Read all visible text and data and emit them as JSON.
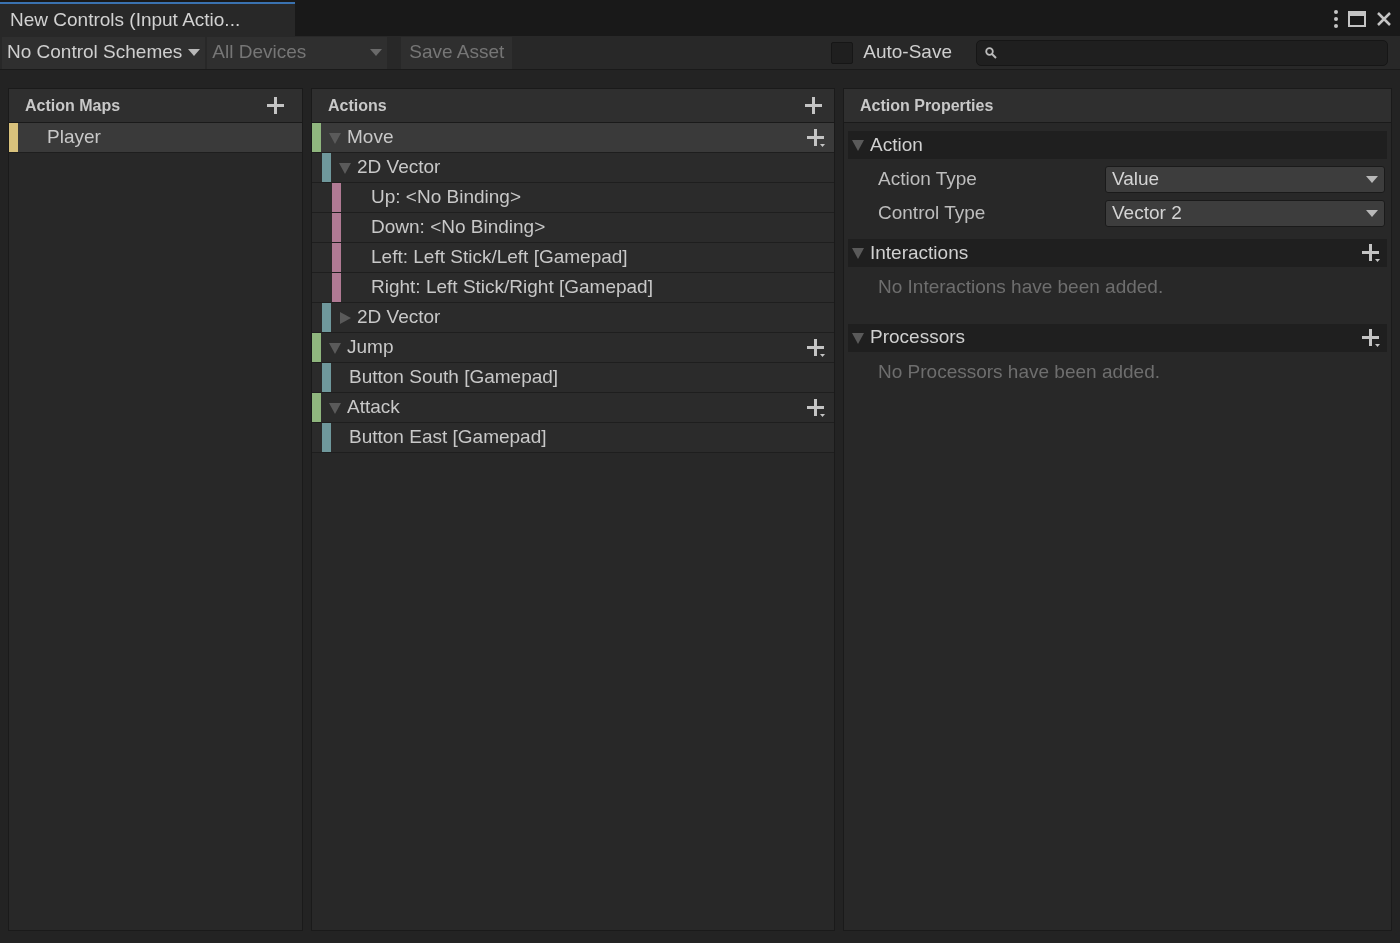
{
  "window": {
    "tab_title": "New Controls (Input Actio..."
  },
  "toolbar": {
    "control_schemes": "No Control Schemes",
    "devices": {
      "label": "All Devices",
      "disabled": true
    },
    "save_asset": {
      "label": "Save Asset",
      "disabled": true
    },
    "auto_save": {
      "label": "Auto-Save",
      "checked": false
    }
  },
  "action_maps": {
    "title": "Action Maps",
    "items": [
      {
        "label": "Player",
        "selected": true,
        "color": "#d9c27c"
      }
    ]
  },
  "actions": {
    "title": "Actions",
    "items": [
      {
        "kind": "action",
        "label": "Move",
        "selected": true,
        "expanded": true,
        "children": [
          {
            "kind": "composite",
            "label": "2D Vector",
            "selected": false,
            "expanded": true,
            "children": [
              {
                "kind": "part",
                "label": "Up: <No Binding>",
                "selected": false
              },
              {
                "kind": "part",
                "label": "Down: <No Binding>",
                "selected": false
              },
              {
                "kind": "part",
                "label": "Left: Left Stick/Left [Gamepad]",
                "selected": false
              },
              {
                "kind": "part",
                "label": "Right: Left Stick/Right [Gamepad]",
                "selected": false
              }
            ]
          },
          {
            "kind": "composite",
            "label": "2D Vector",
            "selected": false,
            "expanded": false
          }
        ]
      },
      {
        "kind": "action",
        "label": "Jump",
        "selected": false,
        "expanded": true,
        "children": [
          {
            "kind": "binding",
            "label": "Button South [Gamepad]",
            "selected": false
          }
        ]
      },
      {
        "kind": "action",
        "label": "Attack",
        "selected": false,
        "expanded": true,
        "children": [
          {
            "kind": "binding",
            "label": "Button East [Gamepad]",
            "selected": false
          }
        ]
      }
    ]
  },
  "properties": {
    "title": "Action Properties",
    "sections": [
      {
        "title": "Action",
        "expanded": true,
        "has_add": false,
        "fields": [
          {
            "label": "Action Type",
            "value": "Value"
          },
          {
            "label": "Control Type",
            "value": "Vector 2"
          }
        ]
      },
      {
        "title": "Interactions",
        "expanded": true,
        "has_add": true,
        "empty_text": "No Interactions have been added."
      },
      {
        "title": "Processors",
        "expanded": true,
        "has_add": true,
        "empty_text": "No Processors have been added."
      }
    ]
  }
}
